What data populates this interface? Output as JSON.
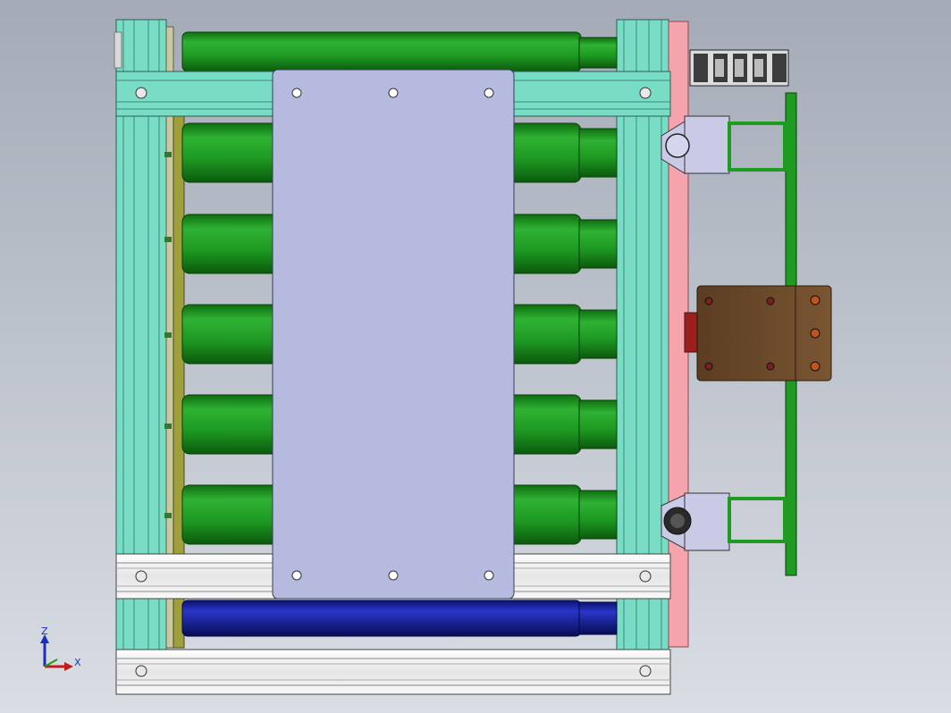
{
  "viewport": {
    "background_top": "#a4abb7",
    "background_bottom": "#d9dde4"
  },
  "colors": {
    "frame": "#79dcc5",
    "roller": "#1f9b22",
    "roller_blue": "#1420a8",
    "plate": "#b6bade",
    "rail": "#f5a3ad",
    "bracket": "#c8cae6",
    "motor": "#6b4a2c",
    "chain": "#3c3c3c",
    "extrusion": "#f4f4f4"
  },
  "triad": {
    "z_label": "Z",
    "x_label": "X"
  },
  "icons": [
    "coordinate-triad-icon"
  ]
}
